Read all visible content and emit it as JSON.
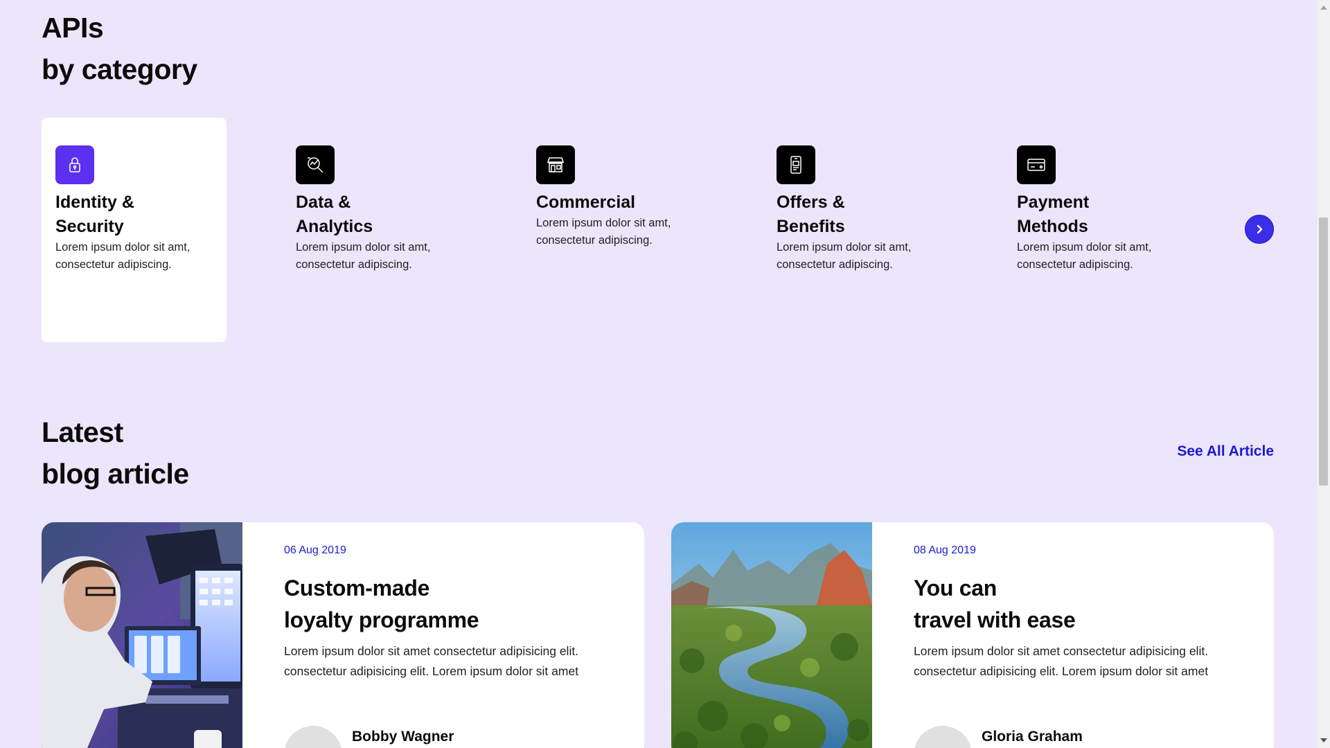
{
  "categories_section": {
    "heading_line1": "APIs",
    "heading_line2": "by category",
    "items": [
      {
        "title_line1": "Identity &",
        "title_line2": "Security",
        "desc_line1": "Lorem ipsum dolor sit amt,",
        "desc_line2": "consectetur adipiscing.",
        "icon": "lock-icon",
        "active": true
      },
      {
        "title_line1": "Data &",
        "title_line2": "Analytics",
        "desc_line1": "Lorem ipsum dolor sit amt,",
        "desc_line2": "consectetur adipiscing.",
        "icon": "analytics-magnifier-icon",
        "active": false
      },
      {
        "title_line1": "Commercial",
        "title_line2": "",
        "desc_line1": "Lorem ipsum dolor sit amt,",
        "desc_line2": "consectetur adipiscing.",
        "icon": "storefront-icon",
        "active": false
      },
      {
        "title_line1": "Offers &",
        "title_line2": "Benefits",
        "desc_line1": "Lorem ipsum dolor sit amt,",
        "desc_line2": "consectetur adipiscing.",
        "icon": "mobile-offer-icon",
        "active": false
      },
      {
        "title_line1": "Payment",
        "title_line2": "Methods",
        "desc_line1": "Lorem ipsum dolor sit amt,",
        "desc_line2": "consectetur adipiscing.",
        "icon": "credit-card-icon",
        "active": false
      }
    ],
    "next_icon": "chevron-right-icon"
  },
  "blog_section": {
    "heading_line1": "Latest",
    "heading_line2": "blog article",
    "see_all_label": "See All Article",
    "articles": [
      {
        "date": "06 Aug 2019",
        "title_line1": "Custom-made",
        "title_line2": "loyalty programme",
        "excerpt_line1": "Lorem ipsum dolor sit amet consectetur adipisicing elit.",
        "excerpt_line2": "consectetur adipisicing elit. Lorem ipsum dolor sit amet",
        "author": "Bobby Wagner"
      },
      {
        "date": "08 Aug 2019",
        "title_line1": "You can",
        "title_line2": "travel with ease",
        "excerpt_line1": "Lorem ipsum dolor sit amet consectetur adipisicing elit.",
        "excerpt_line2": "consectetur adipisicing elit. Lorem ipsum dolor sit amet",
        "author": "Gloria Graham"
      }
    ]
  },
  "colors": {
    "page_bg": "#ece5fc",
    "accent": "#5b30f0",
    "link": "#1a1ad0",
    "card_bg": "#ffffff"
  }
}
